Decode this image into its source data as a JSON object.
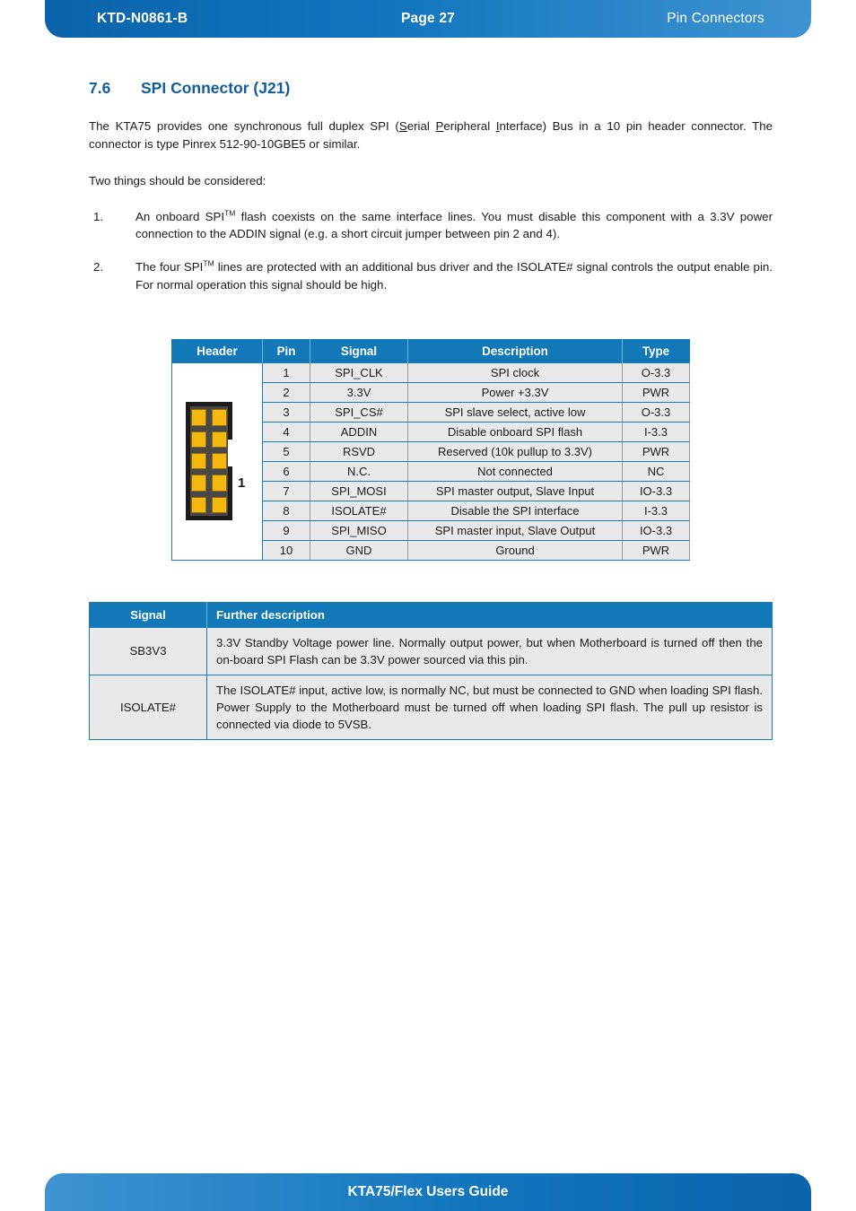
{
  "header": {
    "doc_id": "KTD-N0861-B",
    "page_label": "Page 27",
    "chapter": "Pin Connectors"
  },
  "footer": {
    "title": "KTA75/Flex Users Guide"
  },
  "section": {
    "number": "7.6",
    "title": "SPI Connector (J21)"
  },
  "intro": {
    "para1_a": "The KTA75 provides one synchronous full duplex SPI (",
    "para1_s": "S",
    "para1_b": "erial ",
    "para1_p": "P",
    "para1_c": "eripheral ",
    "para1_i": "I",
    "para1_d": "nterface) Bus in a 10 pin header connector. The connector is type Pinrex 512-90-10GBE5 or similar.",
    "para2": "Two things should be considered:"
  },
  "notes": [
    {
      "marker": "1.",
      "text_a": "An onboard SPI",
      "sup": "TM",
      "text_b": " flash coexists on the same interface lines. You must disable this component with a 3.3V power connection to the ADDIN signal (e.g. a short circuit jumper between pin 2 and 4)."
    },
    {
      "marker": "2.",
      "text_a": "The four SPI",
      "sup": "TM",
      "text_b": " lines are protected with an additional bus driver and the ISOLATE# signal controls the output enable pin. For normal operation this signal should be high."
    }
  ],
  "pin_table": {
    "columns": [
      "Header",
      "Pin",
      "Signal",
      "Description",
      "Type"
    ],
    "connector_label": "1",
    "rows": [
      {
        "pin": "1",
        "signal": "SPI_CLK",
        "description": "SPI clock",
        "type": "O-3.3"
      },
      {
        "pin": "2",
        "signal": "3.3V",
        "description": "Power +3.3V",
        "type": "PWR"
      },
      {
        "pin": "3",
        "signal": "SPI_CS#",
        "description": "SPI slave select, active low",
        "type": "O-3.3"
      },
      {
        "pin": "4",
        "signal": "ADDIN",
        "description": "Disable onboard SPI flash",
        "type": "I-3.3"
      },
      {
        "pin": "5",
        "signal": "RSVD",
        "description": "Reserved (10k pullup to 3.3V)",
        "type": "PWR"
      },
      {
        "pin": "6",
        "signal": "N.C.",
        "description": "Not connected",
        "type": "NC"
      },
      {
        "pin": "7",
        "signal": "SPI_MOSI",
        "description": "SPI master output, Slave Input",
        "type": "IO-3.3"
      },
      {
        "pin": "8",
        "signal": "ISOLATE#",
        "description": "Disable the SPI interface",
        "type": "I-3.3"
      },
      {
        "pin": "9",
        "signal": "SPI_MISO",
        "description": "SPI master input, Slave Output",
        "type": "IO-3.3"
      },
      {
        "pin": "10",
        "signal": "GND",
        "description": "Ground",
        "type": "PWR"
      }
    ]
  },
  "desc_table": {
    "columns": [
      "Signal",
      "Further description"
    ],
    "rows": [
      {
        "signal": "SB3V3",
        "description": "3.3V Standby Voltage power line. Normally output power, but when Motherboard is turned off then the on-board SPI Flash can be 3.3V power sourced via this pin."
      },
      {
        "signal": "ISOLATE#",
        "description": "The ISOLATE# input, active low, is normally NC, but must be connected to GND when loading SPI flash.  Power Supply to the Motherboard must be turned off when loading SPI flash. The pull up resistor is connected via diode to 5VSB."
      }
    ]
  },
  "colors": {
    "brand_blue": "#1278b8",
    "header_dark": "#0a63ab",
    "header_light": "#3e93d1",
    "title_blue": "#115d9e",
    "cell_gray": "#e9e9e9",
    "pin_gold": "#f5b810",
    "connector_body": "#4a4748"
  }
}
